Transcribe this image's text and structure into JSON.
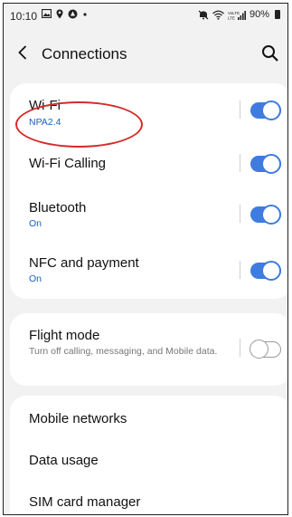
{
  "status_bar": {
    "time": "10:10",
    "left_icons": [
      "gallery-icon",
      "location-icon",
      "notification-icon",
      "dot-icon"
    ],
    "right_icons": [
      "mute-icon",
      "wifi-icon",
      "signal-icon"
    ],
    "battery": "90%"
  },
  "header": {
    "title": "Connections"
  },
  "settings": {
    "wifi": {
      "title": "Wi-Fi",
      "subtitle": "NPA2.4",
      "enabled": true
    },
    "wifi_calling": {
      "title": "Wi-Fi Calling",
      "enabled": true
    },
    "bluetooth": {
      "title": "Bluetooth",
      "subtitle": "On",
      "enabled": true
    },
    "nfc": {
      "title": "NFC and payment",
      "subtitle": "On",
      "enabled": true
    },
    "flight_mode": {
      "title": "Flight mode",
      "subtitle": "Turn off calling, messaging, and Mobile data.",
      "enabled": false
    },
    "mobile_networks": {
      "title": "Mobile networks"
    },
    "data_usage": {
      "title": "Data usage"
    },
    "sim_manager": {
      "title": "SIM card manager"
    }
  },
  "colors": {
    "accent": "#3e7ce0",
    "subtitle_blue": "#1a5fbf",
    "annotation_red": "#d62a2a",
    "background": "#f2f2f2"
  }
}
